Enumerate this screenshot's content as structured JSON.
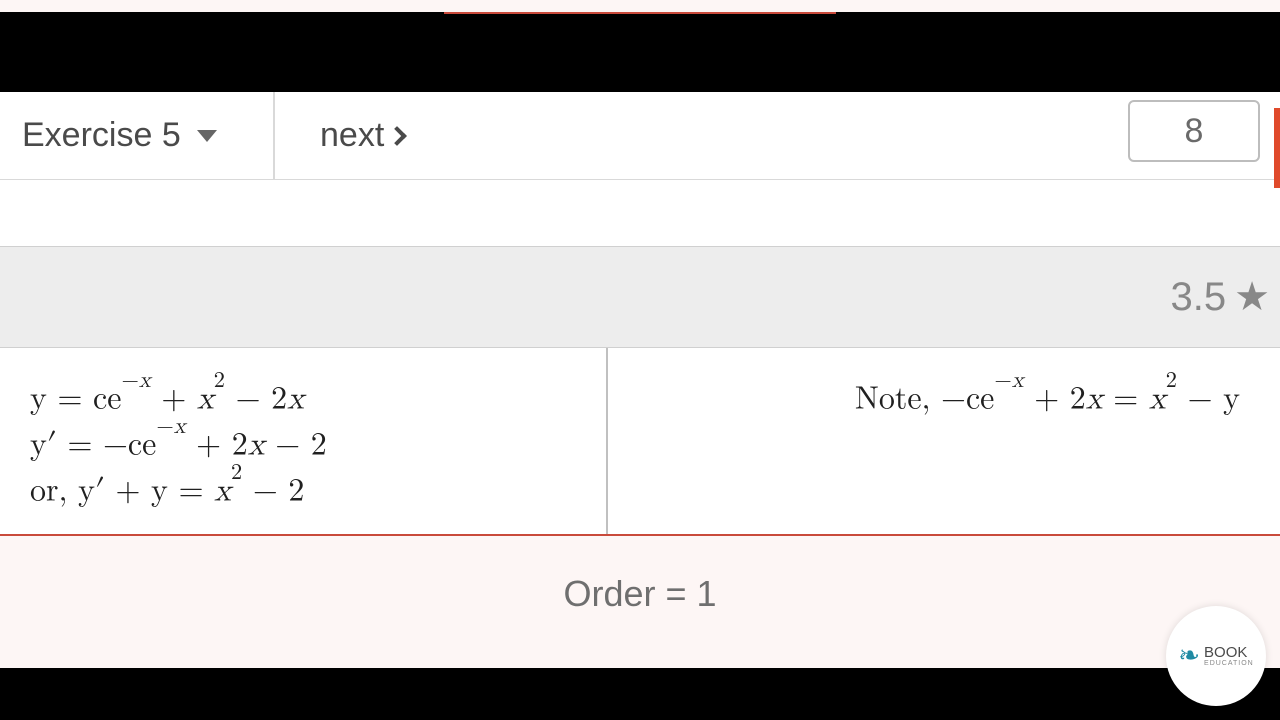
{
  "nav": {
    "exercise_label": "Exercise 5",
    "next_label": "next",
    "page_number": "8"
  },
  "rating": {
    "value": "3.5"
  },
  "content": {
    "left_lines": [
      "y = ce<sup>−<span class='ital'>x</span></sup> + <span class='ital'>x</span><sup>2</sup> − 2<span class='ital'>x</span>",
      "y′ = −ce<sup>−<span class='ital'>x</span></sup> + 2<span class='ital'>x</span> − 2",
      "or, y′ + y = <span class='ital'>x</span><sup>2</sup> − 2"
    ],
    "right_line": "Note, −ce<sup>−<span class='ital'>x</span></sup> + 2<span class='ital'>x</span> = <span class='ital'>x</span><sup>2</sup> − y"
  },
  "order": {
    "label": "Order = 1"
  },
  "logo": {
    "brand": "BOOK",
    "sub": "EDUCATION"
  }
}
